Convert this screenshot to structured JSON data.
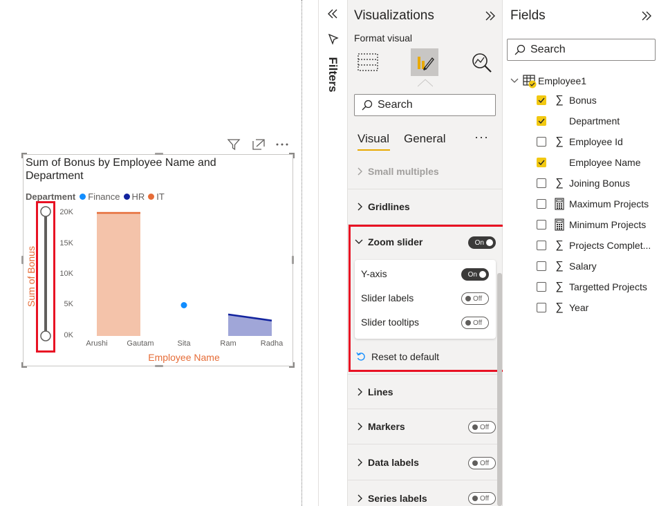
{
  "visual": {
    "title": "Sum of Bonus by Employee Name and Department",
    "legend": {
      "title": "Department",
      "items": [
        {
          "label": "Finance",
          "color": "#118dff"
        },
        {
          "label": "HR",
          "color": "#12239e"
        },
        {
          "label": "IT",
          "color": "#e66c37"
        }
      ]
    },
    "y_axis_title": "Sum of Bonus",
    "x_axis_title": "Employee Name"
  },
  "chart_data": {
    "type": "area",
    "title": "Sum of Bonus by Employee Name and Department",
    "xlabel": "Employee Name",
    "ylabel": "Sum of Bonus",
    "categories": [
      "Arushi",
      "Gautam",
      "Sita",
      "Ram",
      "Radha"
    ],
    "y_ticks": [
      "0K",
      "5K",
      "10K",
      "15K",
      "20K"
    ],
    "ylim": [
      0,
      20000
    ],
    "legend_position": "top-left",
    "series": [
      {
        "name": "Finance",
        "color": "#118dff",
        "values": [
          null,
          null,
          5000,
          null,
          null
        ]
      },
      {
        "name": "HR",
        "color": "#12239e",
        "values": [
          null,
          null,
          null,
          3500,
          2500
        ]
      },
      {
        "name": "IT",
        "color": "#e66c37",
        "values": [
          20000,
          20000,
          null,
          null,
          null
        ]
      }
    ]
  },
  "filters": {
    "label": "Filters"
  },
  "visualizations": {
    "title": "Visualizations",
    "format_visual": "Format visual",
    "search_placeholder": "Search",
    "tabs": {
      "visual": "Visual",
      "general": "General",
      "more": "···"
    },
    "sections": {
      "small_multiples": "Small multiples",
      "gridlines": "Gridlines",
      "zoom_slider": "Zoom slider",
      "lines": "Lines",
      "markers": "Markers",
      "data_labels": "Data labels",
      "series_labels": "Series labels"
    },
    "zoom": {
      "toggle": "On",
      "y_axis": "Y-axis",
      "y_axis_toggle": "On",
      "slider_labels": "Slider labels",
      "slider_labels_toggle": "Off",
      "slider_tooltips": "Slider tooltips",
      "slider_tooltips_toggle": "Off",
      "reset": "Reset to default"
    },
    "markers_toggle": "Off",
    "data_labels_toggle": "Off",
    "series_labels_toggle": "Off"
  },
  "fields": {
    "title": "Fields",
    "search_placeholder": "Search",
    "table": "Employee1",
    "items": [
      {
        "label": "Bonus",
        "checked": true,
        "icon": "sigma-icon"
      },
      {
        "label": "Department",
        "checked": true,
        "icon": "none"
      },
      {
        "label": "Employee Id",
        "checked": false,
        "icon": "sigma-icon"
      },
      {
        "label": "Employee Name",
        "checked": true,
        "icon": "none"
      },
      {
        "label": "Joining Bonus",
        "checked": false,
        "icon": "sigma-icon"
      },
      {
        "label": "Maximum Projects",
        "checked": false,
        "icon": "calculator-icon"
      },
      {
        "label": "Minimum Projects",
        "checked": false,
        "icon": "calculator-icon"
      },
      {
        "label": "Projects Complet...",
        "checked": false,
        "icon": "sigma-icon"
      },
      {
        "label": "Salary",
        "checked": false,
        "icon": "sigma-icon"
      },
      {
        "label": "Targetted Projects",
        "checked": false,
        "icon": "sigma-icon"
      },
      {
        "label": "Year",
        "checked": false,
        "icon": "sigma-icon"
      }
    ]
  }
}
